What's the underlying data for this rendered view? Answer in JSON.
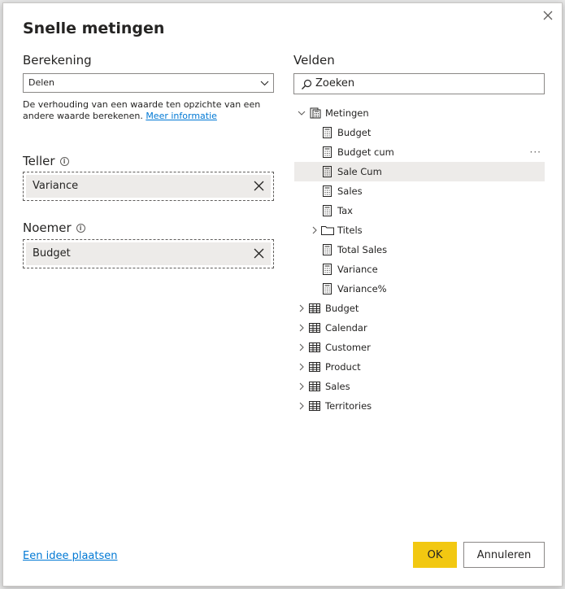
{
  "dialog": {
    "title": "Snelle metingen",
    "close_icon": "close-icon"
  },
  "left": {
    "calc_label": "Berekening",
    "calc_value": "Delen",
    "description": "De verhouding van een waarde ten opzichte van een andere waarde berekenen.",
    "more_info": "Meer informatie",
    "numerator_label": "Teller",
    "numerator_value": "Variance",
    "denominator_label": "Noemer",
    "denominator_value": "Budget"
  },
  "right": {
    "fields_label": "Velden",
    "search_placeholder": "Zoeken",
    "tree": {
      "root": "Metingen",
      "measures": [
        "Budget",
        "Budget cum",
        "Sale Cum",
        "Sales",
        "Tax"
      ],
      "folder": "Titels",
      "measures2": [
        "Total Sales",
        "Variance",
        "Variance%"
      ],
      "tables": [
        "Budget",
        "Calendar",
        "Customer",
        "Product",
        "Sales",
        "Territories"
      ],
      "selected": "Sale Cum",
      "more_icon": "···"
    }
  },
  "footer": {
    "idea_link": "Een idee plaatsen",
    "ok_label": "OK",
    "cancel_label": "Annuleren"
  },
  "colors": {
    "accent": "#f2c811",
    "link": "#0078d4",
    "selected_row": "#edebe9"
  }
}
